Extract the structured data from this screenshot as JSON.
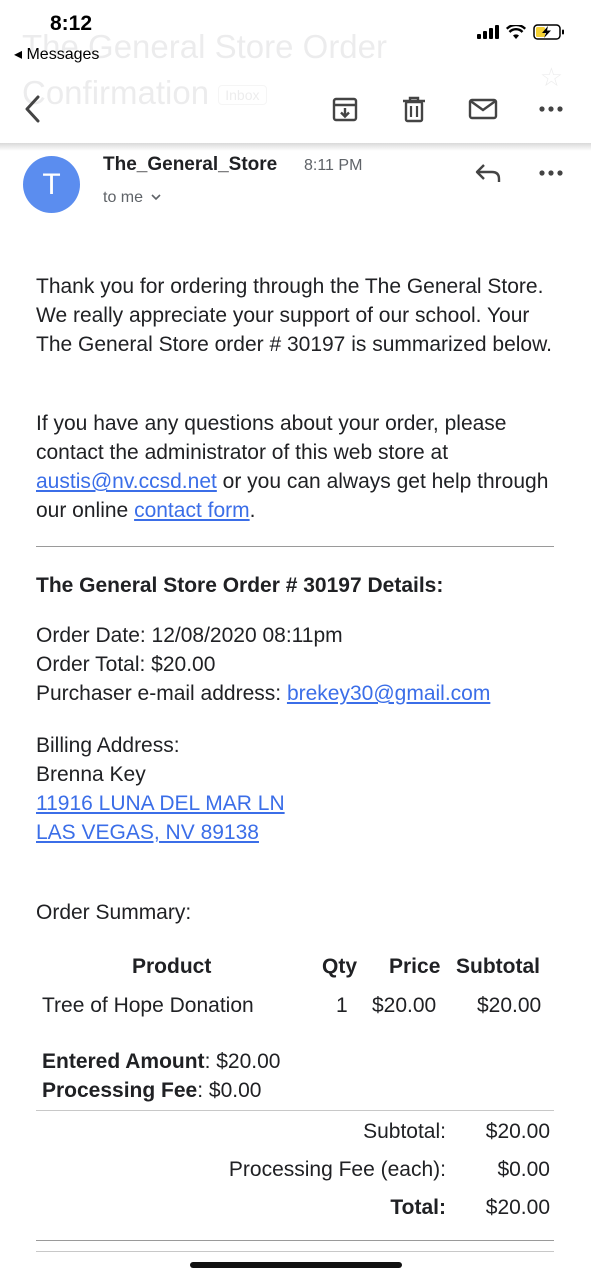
{
  "status_bar": {
    "time": "8:12",
    "back_app": "◂ Messages"
  },
  "subject_ghost": {
    "text": "The General Store Order Confirmation",
    "label": "Inbox"
  },
  "toolbar": {
    "back_icon": "chevron-left-icon",
    "actions": [
      "archive-icon",
      "trash-icon",
      "mail-icon",
      "more-icon"
    ]
  },
  "header": {
    "avatar_initial": "T",
    "sender": "The_General_Store",
    "time": "8:11 PM",
    "recipient": "to me",
    "avatar_color": "#5b8def"
  },
  "body": {
    "intro": "Thank you for ordering through the The General Store. We really appreciate your support of our school. Your The General Store order # 30197  is summarized below.",
    "contact_prefix": "If you have any questions about your order, please contact the administrator of this web store at ",
    "contact_email": "austis@nv.ccsd.net",
    "contact_middle": " or you can always get help through our online ",
    "contact_link": "contact form",
    "contact_suffix": ".",
    "details_title": "The General Store Order # 30197  Details:",
    "order_date": "Order Date: 12/08/2020 08:11pm",
    "order_total": "Order Total: $20.00",
    "purchaser_label": "Purchaser e-mail address: ",
    "purchaser_email": "brekey30@gmail.com",
    "billing_label": "Billing Address:",
    "billing_name": "Brenna Key",
    "billing_street": "11916 LUNA DEL MAR LN",
    "billing_city": "LAS VEGAS, NV 89138",
    "summary_label": "Order Summary:"
  },
  "table": {
    "headers": {
      "product": "Product",
      "qty": "Qty",
      "price": "Price",
      "subtotal": "Subtotal"
    },
    "row": {
      "product": "Tree of Hope Donation",
      "qty": "1",
      "price": "$20.00",
      "subtotal": "$20.00"
    },
    "entered_label": "Entered Amount",
    "entered_value": ": $20.00",
    "fee_label": "Processing Fee",
    "fee_value": ": $0.00"
  },
  "totals": {
    "subtotal_label": "Subtotal:",
    "subtotal_value": "$20.00",
    "fee_label": "Processing Fee (each):",
    "fee_value": "$0.00",
    "total_label": "Total:",
    "total_value": "$20.00"
  },
  "colors": {
    "link": "#3b6ee8",
    "text": "#202124",
    "muted": "#5f6368"
  }
}
